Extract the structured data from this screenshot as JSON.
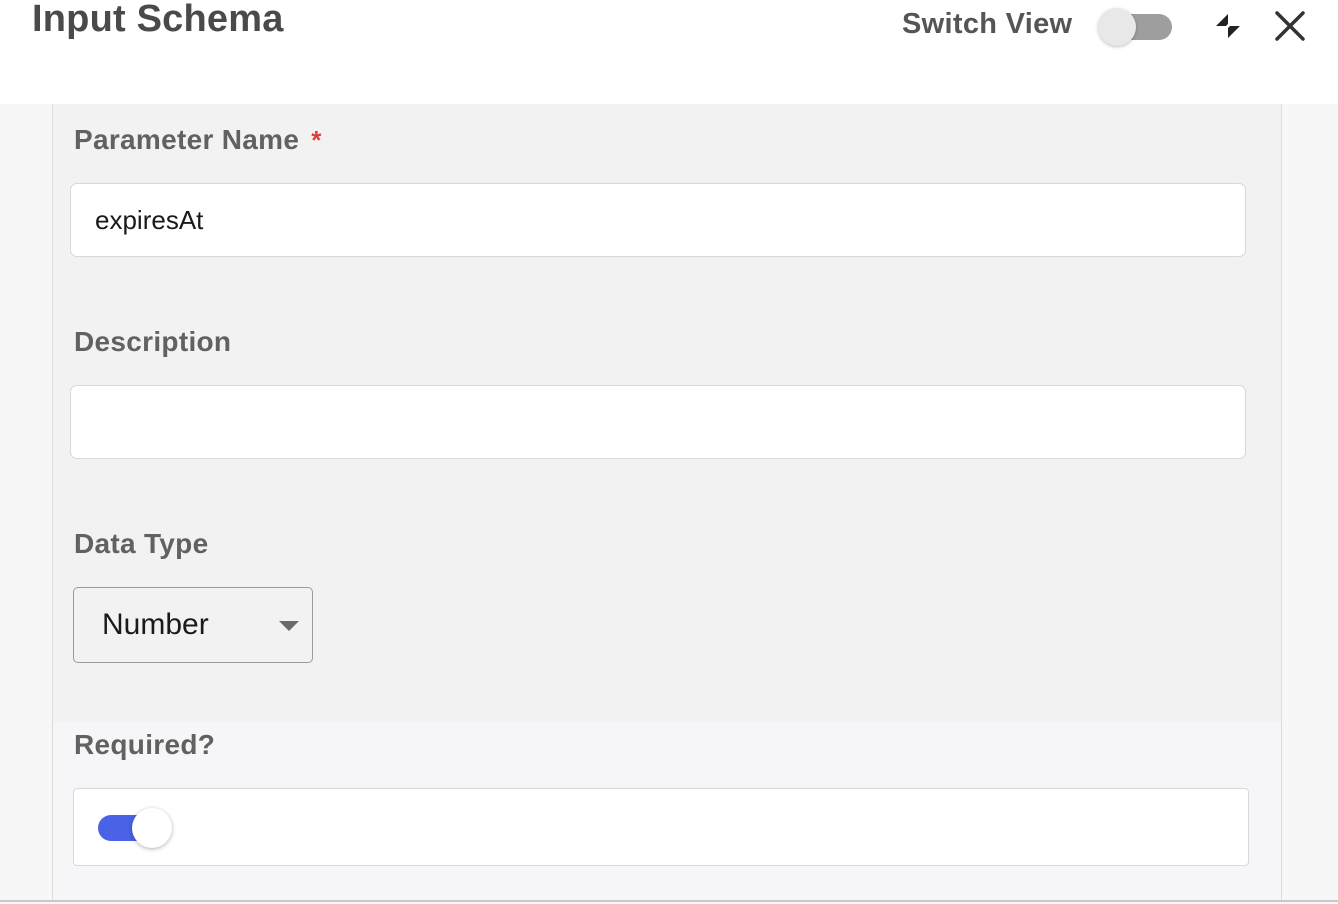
{
  "header": {
    "title": "Input Schema",
    "switch_view_label": "Switch View",
    "switch_view_on": false,
    "expand_icon": "collapse-arrows-icon",
    "close_icon": "close-icon"
  },
  "form": {
    "parameter_name": {
      "label": "Parameter Name",
      "required_marker": "*",
      "value": "expiresAt"
    },
    "description": {
      "label": "Description",
      "value": ""
    },
    "data_type": {
      "label": "Data Type",
      "selected": "Number"
    },
    "required": {
      "label": "Required?",
      "on": true
    }
  },
  "colors": {
    "accent": "#4a63e6",
    "required_star": "#e53935",
    "toggle_off": "#9e9e9e"
  }
}
